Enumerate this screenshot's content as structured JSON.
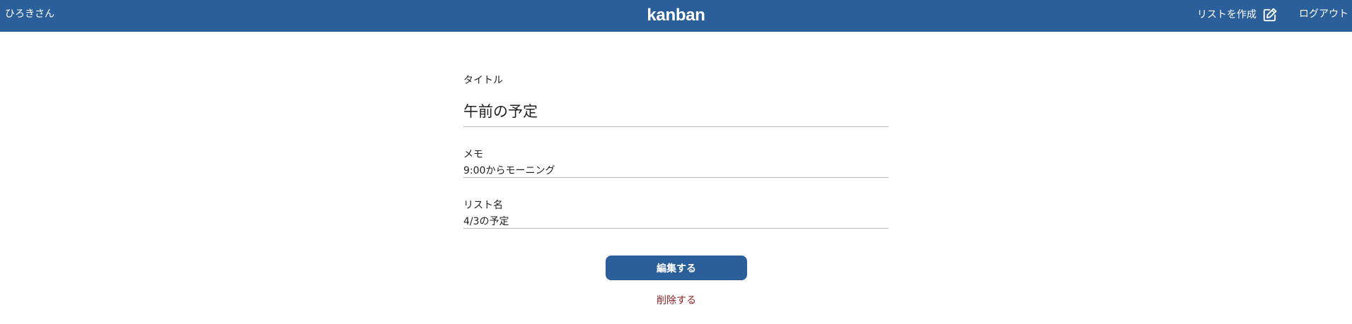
{
  "header": {
    "user_name": "ひろきさん",
    "brand": "kanban",
    "create_list_label": "リストを作成",
    "create_list_icon": "edit-square-icon",
    "logout_label": "ログアウト",
    "background_color": "#2b5f9a"
  },
  "form": {
    "title_label": "タイトル",
    "title_value": "午前の予定",
    "memo_label": "メモ",
    "memo_value": "9:00からモーニング",
    "list_label": "リスト名",
    "list_value": "4/3の予定"
  },
  "actions": {
    "edit_label": "編集する",
    "delete_label": "削除する",
    "edit_color": "#2b5f9a",
    "delete_color": "#8b1c1c"
  }
}
